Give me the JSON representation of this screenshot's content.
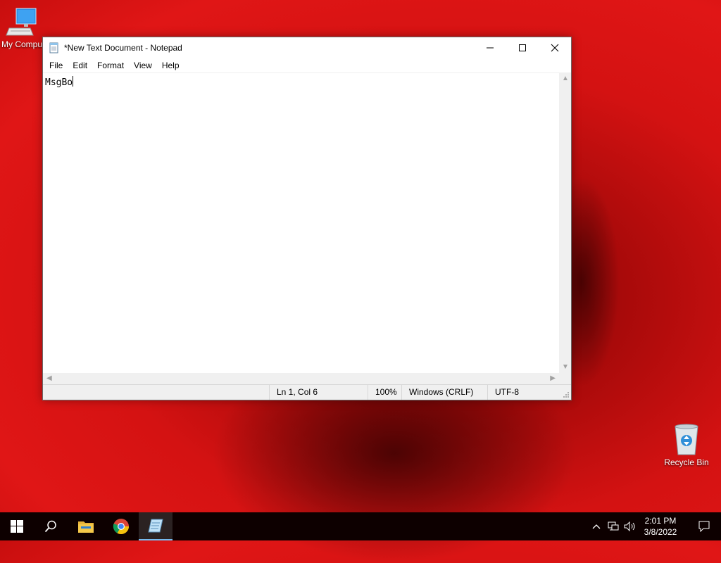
{
  "desktop": {
    "icons": [
      {
        "label": "My Compu",
        "icon": "computer-icon"
      },
      {
        "label": "Recycle Bin",
        "icon": "recycle-bin-icon"
      }
    ]
  },
  "notepad": {
    "title": "*New Text Document - Notepad",
    "menu": [
      "File",
      "Edit",
      "Format",
      "View",
      "Help"
    ],
    "content": "MsgBo",
    "status": {
      "position": "Ln 1, Col 6",
      "zoom": "100%",
      "line_ending": "Windows (CRLF)",
      "encoding": "UTF-8"
    }
  },
  "taskbar": {
    "items": [
      "start-icon",
      "search-icon",
      "file-explorer-icon",
      "chrome-icon",
      "notepad-icon"
    ],
    "active_item": "notepad-icon",
    "time": "2:01 PM",
    "date": "3/8/2022"
  },
  "colors": {
    "taskbar_bg": "#0d0000",
    "active_indicator": "#76b9ed",
    "desktop_red": "#d41212"
  }
}
